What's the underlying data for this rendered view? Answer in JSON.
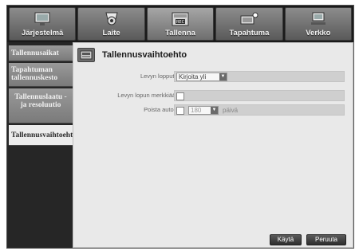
{
  "tabs": [
    {
      "label": "Järjestelmä",
      "icon": "monitor-icon"
    },
    {
      "label": "Laite",
      "icon": "camera-icon"
    },
    {
      "label": "Tallenna",
      "icon": "rec-icon"
    },
    {
      "label": "Tapahtuma",
      "icon": "event-icon"
    },
    {
      "label": "Verkko",
      "icon": "network-icon"
    }
  ],
  "active_tab": "Tallenna",
  "sidebar": {
    "items": [
      {
        "label": "Tallennusaikat"
      },
      {
        "label": "Tapahtuman tallennuskesto"
      },
      {
        "label": "Tallennuslaatu - ja resoluutio"
      },
      {
        "label": "Tallennusvaihtoehto"
      }
    ]
  },
  "main": {
    "title": "Tallennusvaihtoehto",
    "rows": [
      {
        "label": "Levyn lopputila",
        "select_value": "Kirjoita yli"
      },
      {
        "label": "Levyn lopun merkkiääni"
      },
      {
        "label": "Poista autom.",
        "select_value": "180",
        "unit": "päivä"
      }
    ]
  },
  "buttons": {
    "apply": "Käytä",
    "cancel": "Peruuta"
  },
  "colors": {
    "frame": "#1e1e1e",
    "panel": "#e9e9e9",
    "tab": "#7a7a7a",
    "field": "#cfcfcf"
  }
}
